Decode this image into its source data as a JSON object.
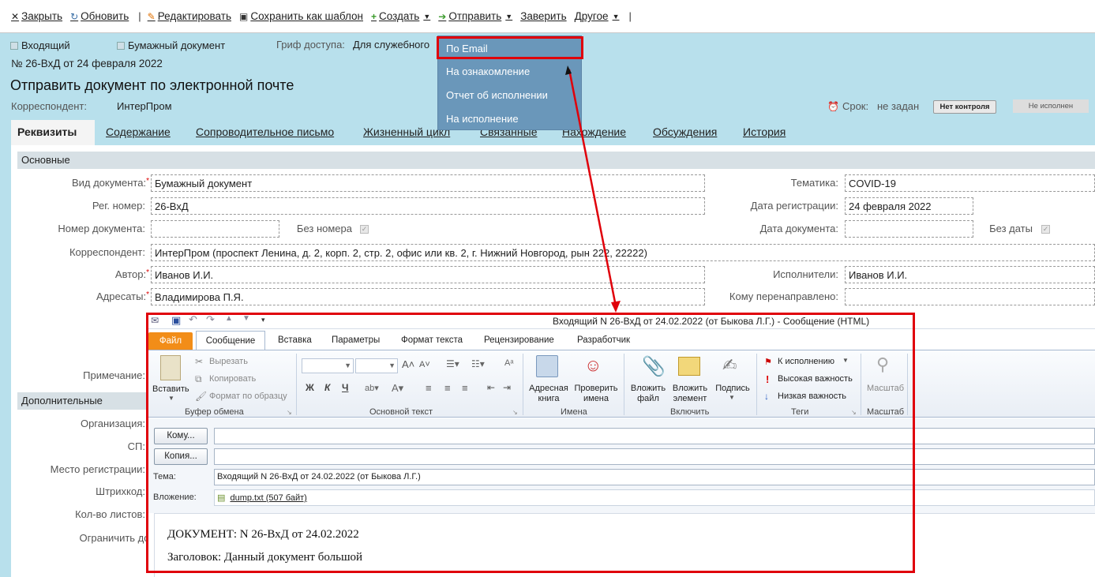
{
  "toolbar": {
    "close": "Закрыть",
    "refresh": "Обновить",
    "edit": "Редактировать",
    "save_template": "Сохранить как шаблон",
    "create": "Создать",
    "send": "Отправить",
    "certify": "Заверить",
    "other": "Другое"
  },
  "header": {
    "flag_incoming": "Входящий",
    "flag_paper": "Бумажный документ",
    "grif_label": "Гриф доступа:",
    "grif_value": "Для служебного",
    "reg_line": "№  26-ВхД  от  24 февраля 2022",
    "title": "Отправить документ по электронной почте",
    "correspondent_label": "Корреспондент:",
    "correspondent_value": "ИнтерПром",
    "deadline_label": "Срок:",
    "deadline_value": "не задан",
    "no_control": "Нет контроля",
    "not_executed": "Не исполнен"
  },
  "tabs": [
    "Реквизиты",
    "Содержание",
    "Сопроводительное письмо",
    "Жизненный цикл",
    "Связанные",
    "Нахождение",
    "Обсуждения",
    "История"
  ],
  "form": {
    "section_main": "Основные",
    "section_extra": "Дополнительные",
    "doc_type_label": "Вид документа:",
    "doc_type_value": "Бумажный документ",
    "theme_label": "Тематика:",
    "theme_value": "COVID-19",
    "reg_num_label": "Рег. номер:",
    "reg_num_value": "26-ВхД",
    "reg_date_label": "Дата регистрации:",
    "reg_date_value": "24 февраля 2022",
    "doc_num_label": "Номер документа:",
    "no_number_label": "Без номера",
    "doc_date_label": "Дата документа:",
    "no_date_label": "Без даты",
    "correspondent_label": "Корреспондент:",
    "correspondent_value": "ИнтерПром (проспект Ленина, д. 2, корп. 2, стр. 2, офис или кв. 2, г. Нижний Новгород, рын 222, 22222)",
    "author_label": "Автор:",
    "author_value": "Иванов И.И.",
    "executors_label": "Исполнители:",
    "executors_value": "Иванов И.И.",
    "addressees_label": "Адресаты:",
    "addressees_value": "Владимирова П.Я.",
    "redirected_label": "Кому перенаправлено:",
    "note_label": "Примечание:",
    "org_label": "Организация:",
    "sp_label": "СП:",
    "place_label": "Место регистрации:",
    "barcode_label": "Штрихкод:",
    "sheets_label": "Кол-во листов:",
    "restrict_label": "Ограничить дос"
  },
  "send_menu": [
    "По Email",
    "На ознакомление",
    "Отчет об исполнении",
    "На исполнение"
  ],
  "outlook": {
    "window_title": "Входящий N 26-ВхД от 24.02.2022 (от Быкова Л.Г.)  -  Сообщение (HTML)",
    "tabs": [
      "Файл",
      "Сообщение",
      "Вставка",
      "Параметры",
      "Формат текста",
      "Рецензирование",
      "Разработчик"
    ],
    "clipboard": {
      "paste": "Вставить",
      "cut": "Вырезать",
      "copy": "Копировать",
      "format_painter": "Формат по образцу",
      "group": "Буфер обмена"
    },
    "basic_text_group": "Основной текст",
    "names": {
      "address_book_1": "Адресная",
      "address_book_2": "книга",
      "check_1": "Проверить",
      "check_2": "имена",
      "group": "Имена"
    },
    "include": {
      "attach_1": "Вложить",
      "attach_2": "файл",
      "item_1": "Вложить",
      "item_2": "элемент",
      "signature": "Подпись",
      "group": "Включить"
    },
    "tags": {
      "followup": "К исполнению",
      "high": "Высокая важность",
      "low": "Низкая важность",
      "group": "Теги"
    },
    "zoom": {
      "label": "Масштаб",
      "group": "Масштаб"
    },
    "to_btn": "Кому...",
    "cc_btn": "Копия...",
    "subject_label": "Тема:",
    "subject_value": "Входящий N 26-ВхД от 24.02.2022 (от Быкова Л.Г.)",
    "attach_label": "Вложение:",
    "attach_value": "dump.txt (507 байт)",
    "body_line1": "ДОКУМЕНТ: N 26-ВхД от 24.02.2022",
    "body_line2": "Заголовок: Данный документ большой"
  },
  "colors": {
    "accent_red": "#e0000a",
    "menu_blue": "#6a97ba",
    "bg_cyan": "#b8e0ec",
    "office_orange": "#f28d18"
  }
}
